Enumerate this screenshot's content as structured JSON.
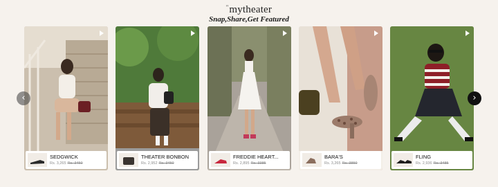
{
  "header": {
    "brand_mark": "\"",
    "brand_name": "mytheater",
    "tagline": "Snap,Share,Get Featured"
  },
  "icons": {
    "play": "play-icon",
    "prev": "chevron-left-icon",
    "next": "chevron-right-icon"
  },
  "nav": {
    "prev": "‹",
    "next": "›"
  },
  "cards": [
    {
      "name": "SEDGWICK",
      "price": "Rs. 3,265",
      "old_price": "Rs. 3450"
    },
    {
      "name": "THEATER BONBON",
      "price": "Rs. 2,952",
      "old_price": "Rs. 3450"
    },
    {
      "name": "FREDDIE HEART...",
      "price": "Rs. 2,895",
      "old_price": "Rs. 3385"
    },
    {
      "name": "BARA'S",
      "price": "Rs. 3,265",
      "old_price": "Rs. 3850"
    },
    {
      "name": "FLING",
      "price": "Rs. 2,936",
      "old_price": "Rs. 3485"
    }
  ]
}
